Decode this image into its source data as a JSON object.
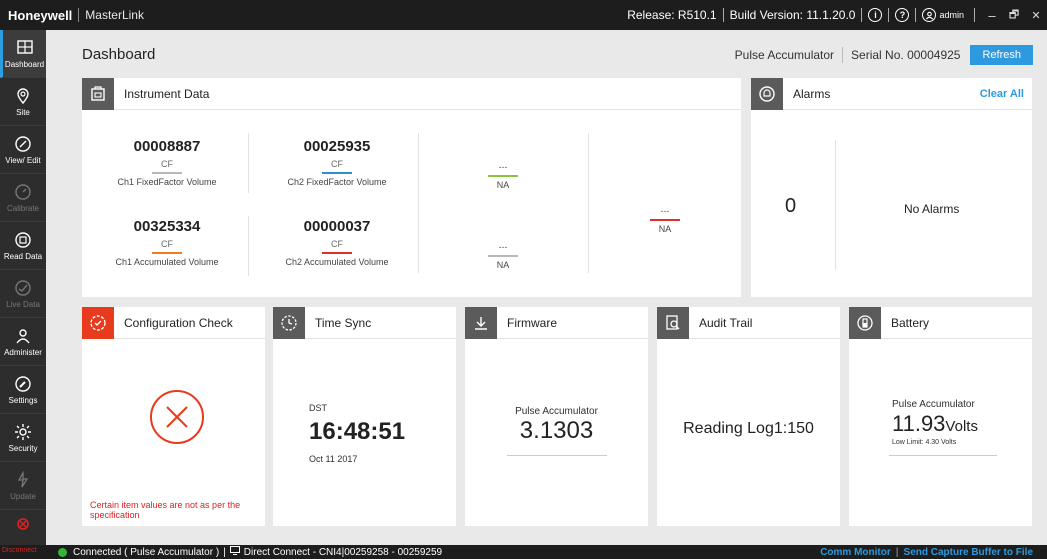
{
  "titlebar": {
    "brand": "Honeywell",
    "app": "MasterLink",
    "release": "Release: R510.1",
    "build": "Build Version: 11.1.20.0",
    "info_glyph": "i",
    "help_glyph": "?",
    "user": "admin",
    "min_glyph": "–",
    "restore_glyph": "🗗",
    "close_glyph": "✕"
  },
  "nav": {
    "items": [
      {
        "label": "Dashboard",
        "icon": "dashboard-icon",
        "state": "active"
      },
      {
        "label": "Site",
        "icon": "location-pin-icon",
        "state": "enabled"
      },
      {
        "label": "View/ Edit",
        "icon": "view-edit-icon",
        "state": "enabled"
      },
      {
        "label": "Calibrate",
        "icon": "calibrate-icon",
        "state": "disabled"
      },
      {
        "label": "Read Data",
        "icon": "read-data-icon",
        "state": "enabled"
      },
      {
        "label": "Live Data",
        "icon": "live-data-icon",
        "state": "disabled"
      },
      {
        "label": "Administer",
        "icon": "administer-icon",
        "state": "enabled"
      },
      {
        "label": "Settings",
        "icon": "settings-icon",
        "state": "enabled"
      },
      {
        "label": "Security",
        "icon": "security-icon",
        "state": "enabled"
      },
      {
        "label": "Update",
        "icon": "update-icon",
        "state": "disabled"
      }
    ],
    "disconnect": "Disconnect"
  },
  "header": {
    "title": "Dashboard",
    "device": "Pulse Accumulator",
    "serial": "Serial No. 00004925",
    "refresh": "Refresh"
  },
  "instrument": {
    "title": "Instrument Data",
    "cells": [
      {
        "value": "00008887",
        "unit": "CF",
        "label": "Ch1 FixedFactor Volume",
        "color": "#b8b8b8"
      },
      {
        "value": "00025935",
        "unit": "CF",
        "label": "Ch2 FixedFactor Volume",
        "color": "#2b8fd0"
      },
      {
        "value": "00325334",
        "unit": "CF",
        "label": "Ch1 Accumulated Volume",
        "color": "#f07a2a"
      },
      {
        "value": "00000037",
        "unit": "CF",
        "label": "Ch2 Accumulated Volume",
        "color": "#e0302a"
      }
    ],
    "na_cells": [
      {
        "value": "---",
        "label": "NA",
        "color": "#8ac43a"
      },
      {
        "value": "---",
        "label": "NA",
        "color": "#b8b8b8"
      },
      {
        "value": "---",
        "label": "NA",
        "color": "#e0302a"
      }
    ]
  },
  "alarms": {
    "title": "Alarms",
    "clear": "Clear All",
    "count": "0",
    "message": "No Alarms"
  },
  "config": {
    "title": "Configuration Check",
    "message": "Certain item values are not as per the specification",
    "status_color": "#e83a1c"
  },
  "timesync": {
    "title": "Time Sync",
    "dst": "DST",
    "time": "16:48:51",
    "date": "Oct 11 2017"
  },
  "firmware": {
    "title": "Firmware",
    "device": "Pulse Accumulator",
    "version": "3.1303"
  },
  "audit": {
    "title": "Audit Trail",
    "text": "Reading Log1:150"
  },
  "battery": {
    "title": "Battery",
    "device": "Pulse Accumulator",
    "value": "11.93",
    "unit": "Volts",
    "limit": "Low Limit: 4.30 Volts"
  },
  "status": {
    "connected": "Connected  ( Pulse Accumulator )",
    "connection": "Direct Connect - CNI4|00259258 - 00259259",
    "comm": "Comm Monitor",
    "capture": "Send Capture Buffer to File",
    "connected_color": "#35b535"
  }
}
